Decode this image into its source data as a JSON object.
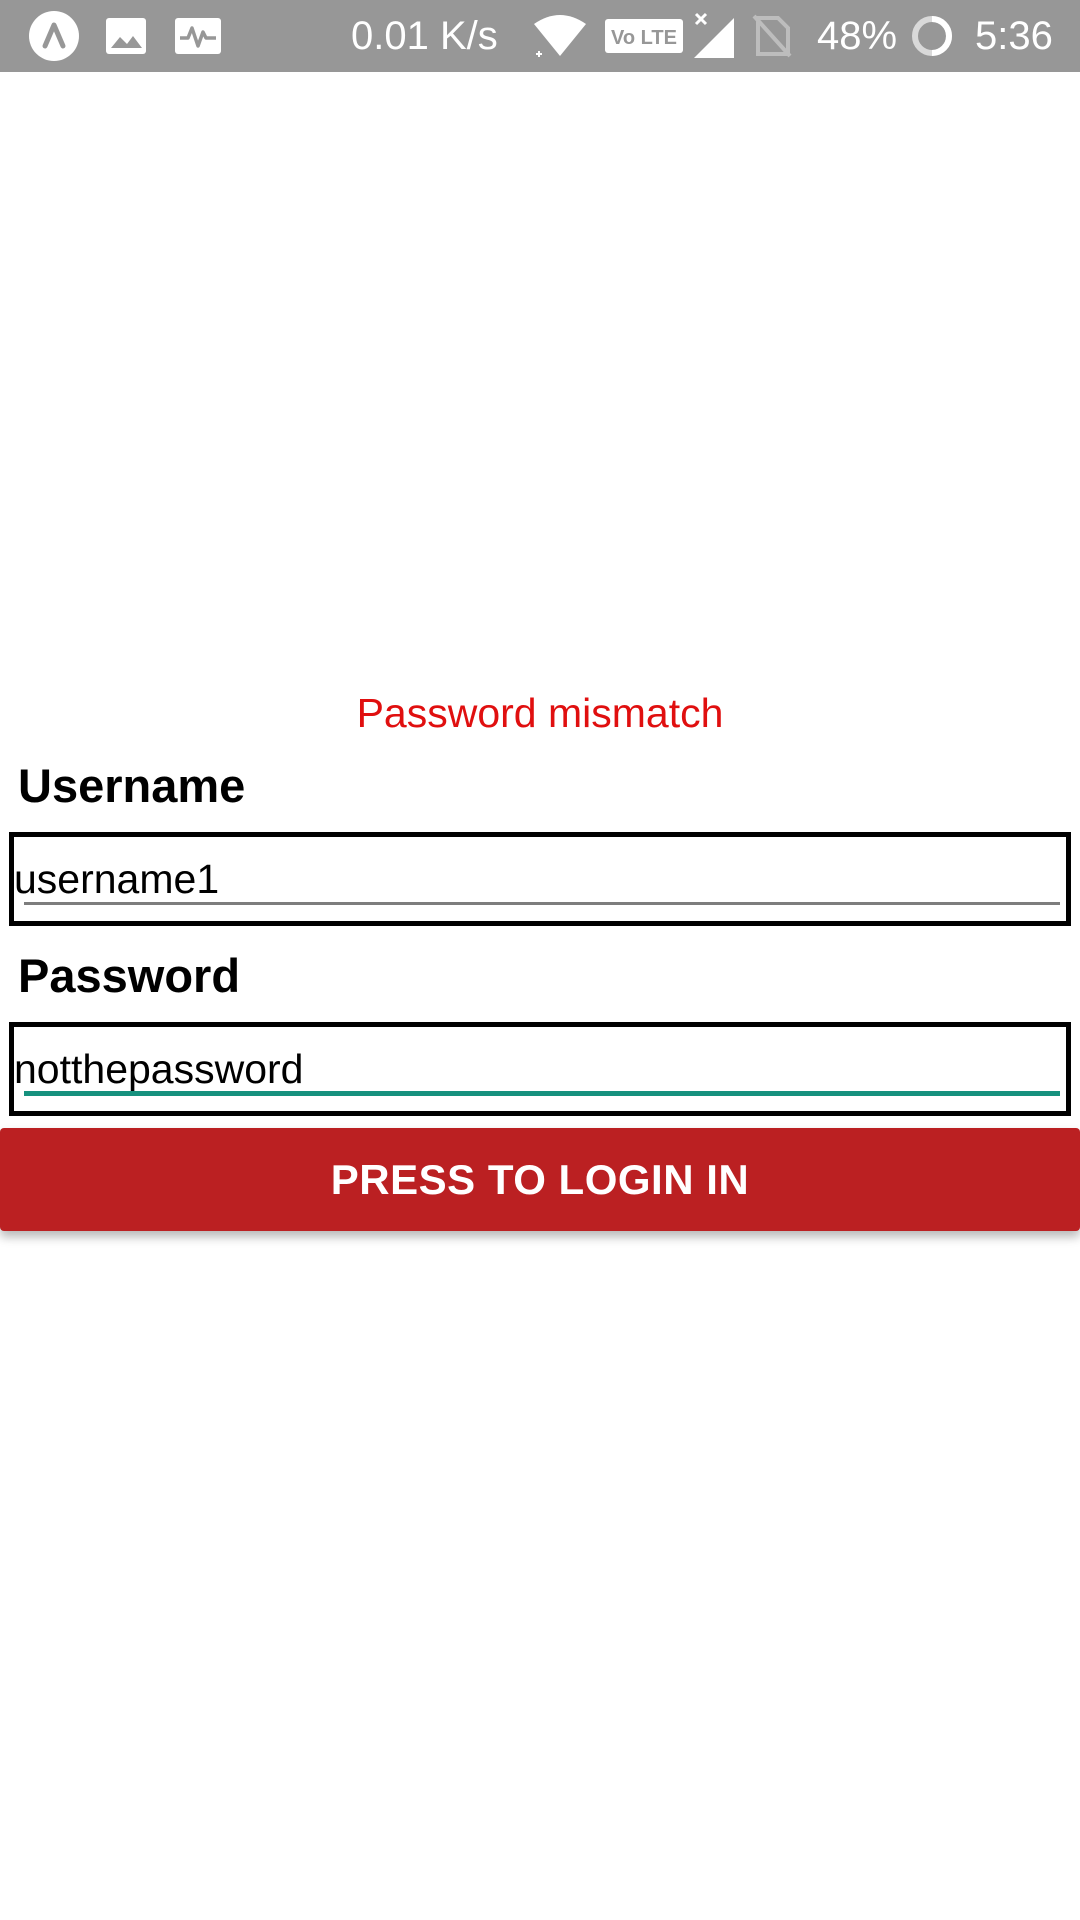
{
  "status_bar": {
    "net_speed": "0.01 K/s",
    "volte_label": "Vo LTE",
    "battery_percent": "48%",
    "time": "5:36",
    "icons": [
      "app-launcher-icon",
      "image-icon",
      "activity-icon",
      "wifi-icon",
      "volte-icon",
      "signal-icon",
      "no-sim-icon",
      "battery-icon"
    ]
  },
  "error_message": "Password mismatch",
  "username": {
    "label": "Username",
    "value": "username1"
  },
  "password": {
    "label": "Password",
    "value": "notthepassword"
  },
  "login_button": {
    "label": "PRESS TO LOGIN IN"
  },
  "colors": {
    "status_bar_bg": "#979797",
    "error_text": "#e00f0f",
    "button_bg": "#bb2022",
    "focused_underline": "#16917e"
  }
}
